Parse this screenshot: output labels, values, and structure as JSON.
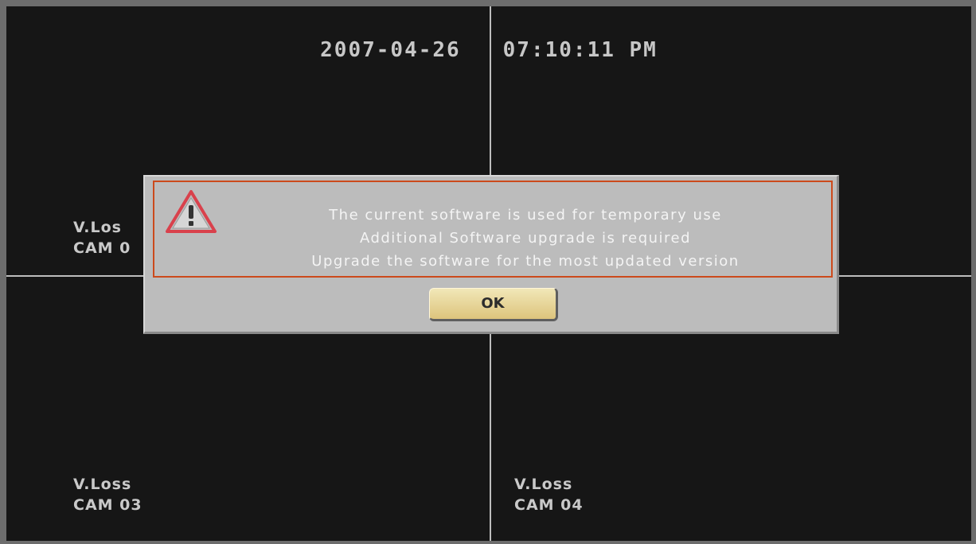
{
  "datetime": "2007-04-26   07:10:11 PM",
  "cameras": [
    {
      "status": "V.Los",
      "name": "CAM 0"
    },
    {
      "status": "V.Loss",
      "name": "CAM 03"
    },
    {
      "status": "V.Loss",
      "name": "CAM 04"
    }
  ],
  "dialog": {
    "icon": "warning-triangle-icon",
    "messages": [
      "The current software is used for temporary use",
      "Additional Software upgrade is required",
      "Upgrade the software for the most updated version"
    ],
    "ok_label": "OK"
  },
  "colors": {
    "background": "#161616",
    "grid_line": "#bdbdbd",
    "dialog_bg": "#bcbcbc",
    "highlight_border": "#cc4a1c",
    "button_bg": "#e8d79a",
    "warning_icon": "#d9414c"
  }
}
